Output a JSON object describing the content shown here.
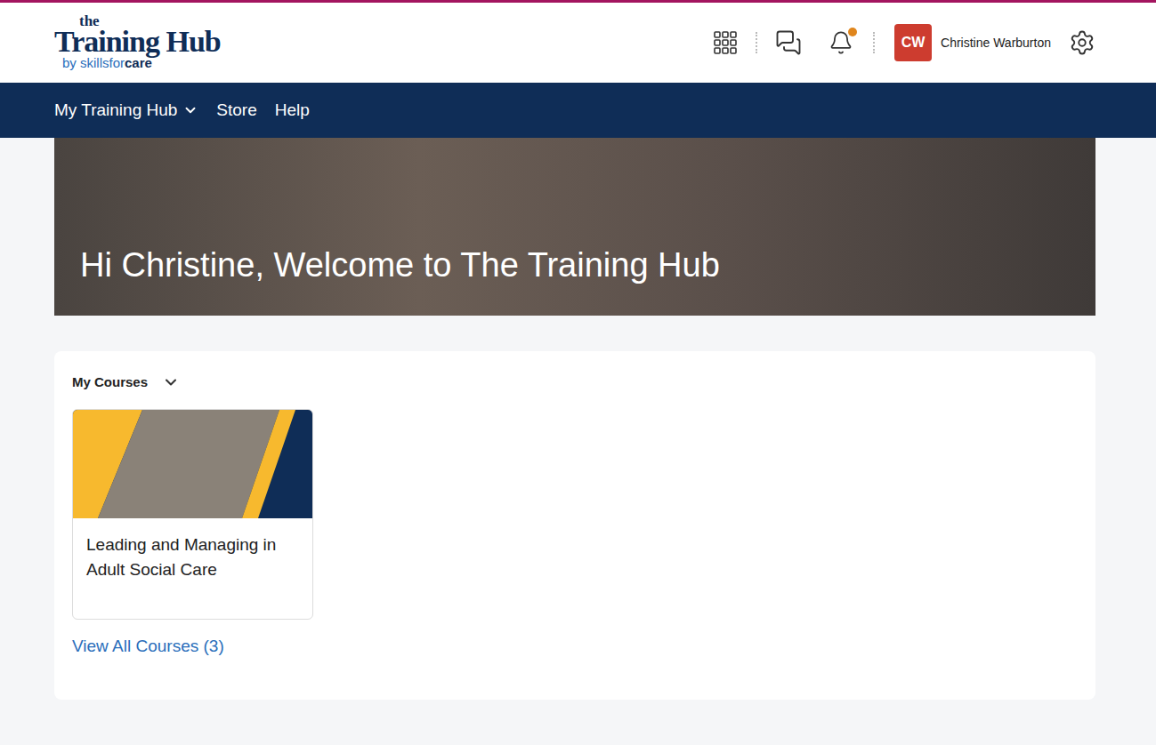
{
  "logo": {
    "top": "the",
    "main": "Training Hub",
    "by": "by",
    "brand": "skillsfor",
    "brand_end": "care"
  },
  "user": {
    "initials": "CW",
    "name": "Christine Warburton",
    "notifications_unread": true
  },
  "nav": [
    {
      "label": "My Training Hub",
      "dropdown": true
    },
    {
      "label": "Store",
      "dropdown": false
    },
    {
      "label": "Help",
      "dropdown": false
    }
  ],
  "hero": {
    "title": "Hi Christine, Welcome to The Training Hub"
  },
  "courses_widget": {
    "title": "My Courses",
    "courses": [
      {
        "title": "Leading and Managing in Adult Social Care"
      }
    ],
    "view_all": "View All Courses (3)"
  }
}
